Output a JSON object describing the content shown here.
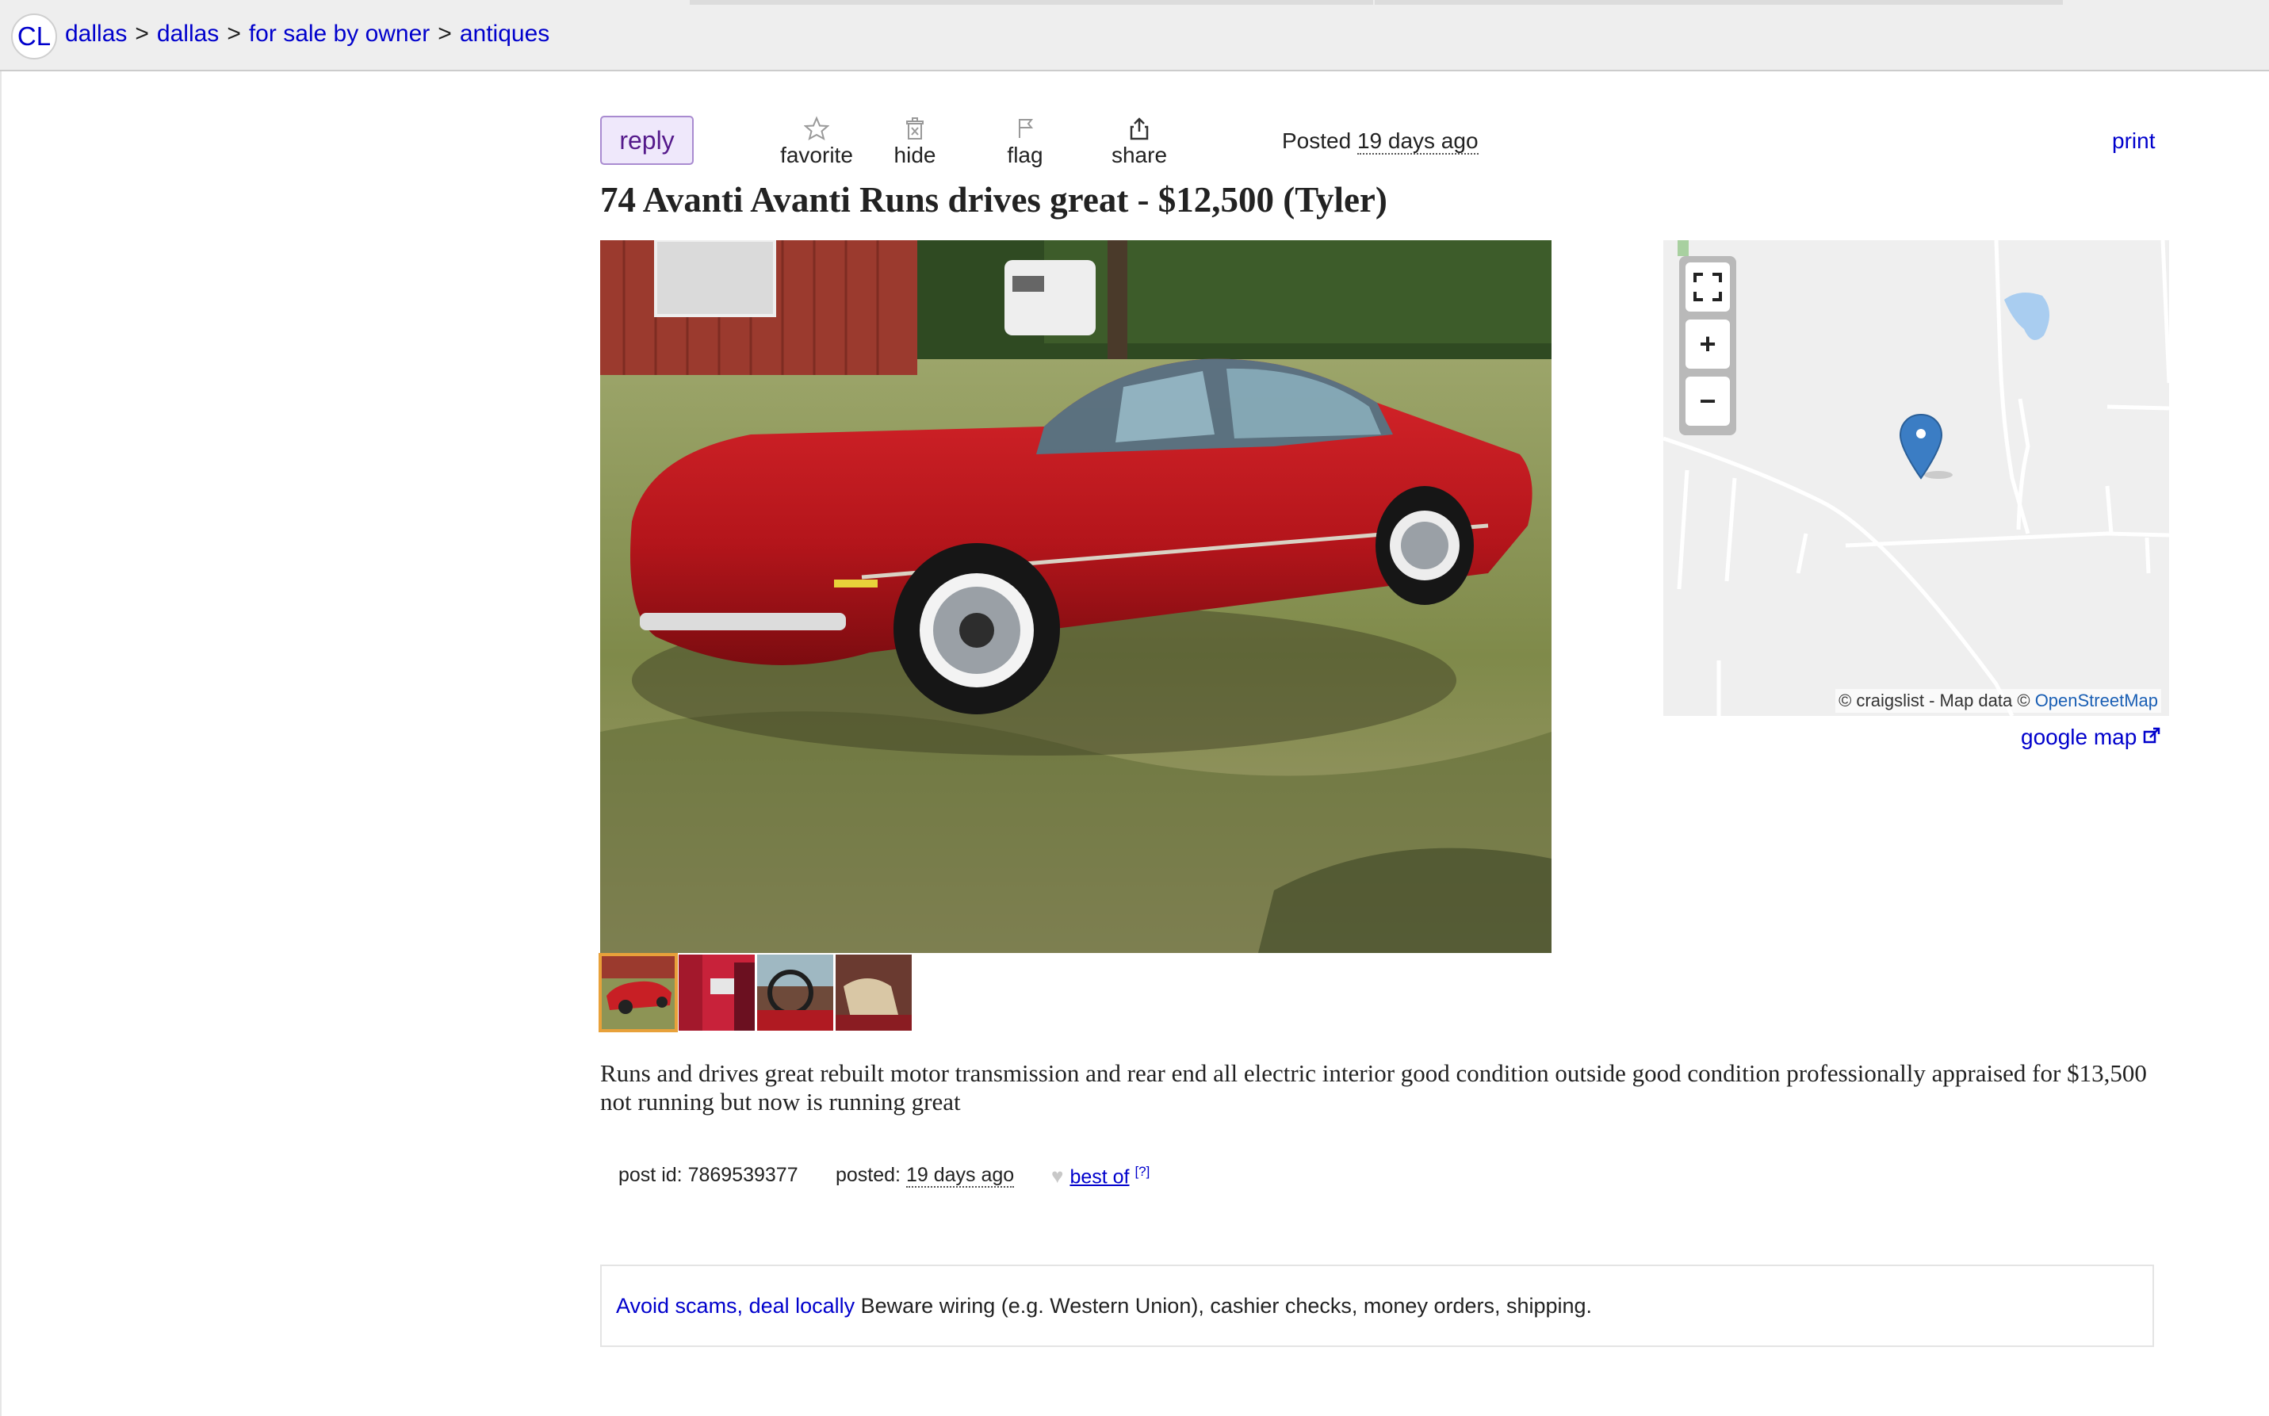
{
  "logo": "CL",
  "breadcrumb": [
    "dallas",
    "dallas",
    "for sale by owner",
    "antiques"
  ],
  "breadcrumb_sep": ">",
  "actions": {
    "reply": "reply",
    "favorite": "favorite",
    "hide": "hide",
    "flag": "flag",
    "share": "share",
    "posted_label": "Posted",
    "posted_ago": "19 days ago",
    "print": "print"
  },
  "listing": {
    "title": "74 Avanti Avanti Runs drives great - $12,500 (Tyler)",
    "description": "Runs and drives great rebuilt motor transmission and rear end all electric interior good condition outside good condition professionally appraised for $13,500 not running but now is running great",
    "thumbnail_count": 4,
    "selected_thumbnail": 0
  },
  "map": {
    "attribution_prefix": "© craigslist - Map data ©",
    "attribution_link": "OpenStreetMap",
    "google_map": "google map",
    "controls": [
      "fullscreen-icon",
      "zoom-in-icon",
      "zoom-out-icon"
    ],
    "marker_color": "#3b7dc4"
  },
  "postinfo": {
    "post_id_label": "post id:",
    "post_id": "7869539377",
    "posted_label": "posted:",
    "posted_ago": "19 days ago",
    "best_of": "best of",
    "help": "[?]"
  },
  "scam": {
    "link": "Avoid scams, deal locally",
    "text": "Beware wiring (e.g. Western Union), cashier checks, money orders, shipping."
  },
  "colors": {
    "link": "#0000cc",
    "reply_text": "#551a8b",
    "reply_bg": "#efe8fb",
    "thumb_selected": "#e8a13a"
  }
}
